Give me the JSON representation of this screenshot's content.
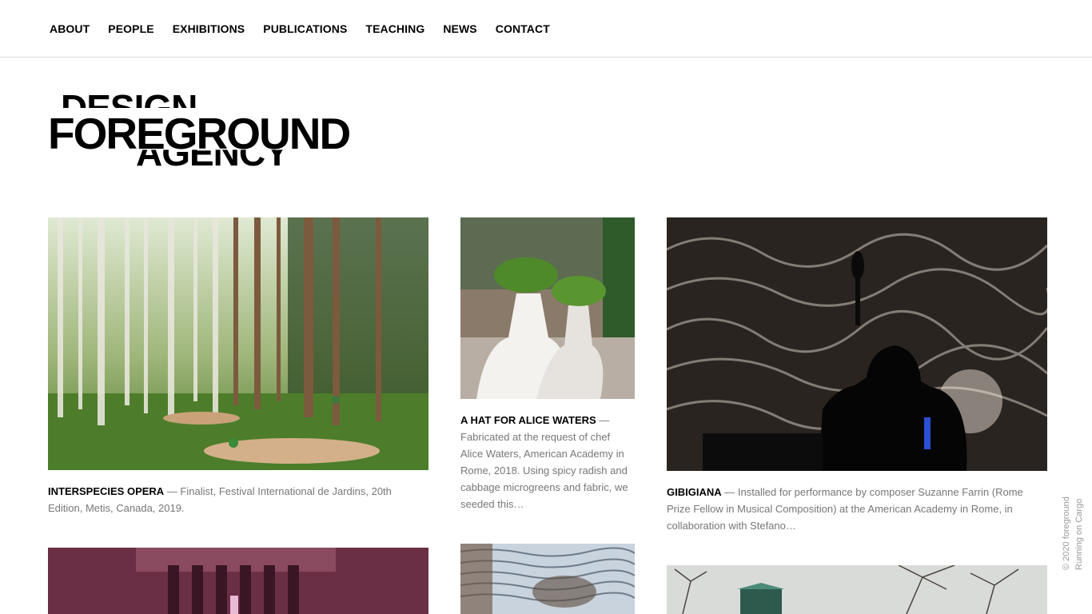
{
  "nav": {
    "items": [
      "ABOUT",
      "PEOPLE",
      "EXHIBITIONS",
      "PUBLICATIONS",
      "TEACHING",
      "NEWS",
      "CONTACT"
    ]
  },
  "logo": {
    "top": "DESIGN",
    "main": "FOREGROUND",
    "bottom": "AGENCY"
  },
  "projects": [
    {
      "title": "INTERSPECIES OPERA",
      "desc": " — Finalist, Festival International de Jardins, 20th Edition, Metis, Canada, 2019."
    },
    {
      "title": "A HAT FOR ALICE WATERS",
      "desc": " — Fabricated at the request of chef Alice Waters, American Academy in Rome, 2018. Using spicy radish and cabbage microgreens and fabric, we seeded this…"
    },
    {
      "title": "GIBIGIANA",
      "desc": " — Installed for performance by composer Suzanne Farrin (Rome Prize Fellow in Musical Composition) at the American Academy in Rome, in collaboration with Stefano…"
    }
  ],
  "credit": {
    "line1": "© 2020 foreground",
    "line2": "Running on Cargo"
  }
}
